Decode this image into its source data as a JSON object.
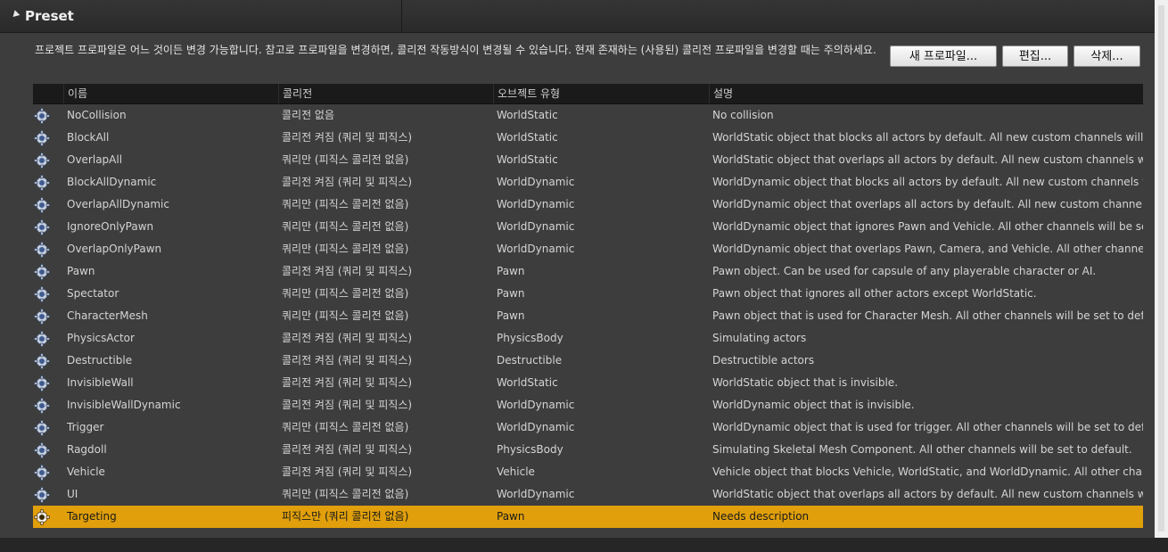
{
  "header": {
    "title": "Preset"
  },
  "description": "프로젝트 프로파일은 어느 것이든 변경 가능합니다. 참고로 프로파일을 변경하면, 콜리전 작동방식이 변경될 수 있습니다. 현재 존재하는 (사용된) 콜리전 프로파일을 변경할 때는 주의하세요.",
  "buttons": {
    "new": "새 프로파일...",
    "edit": "편집...",
    "delete": "삭제..."
  },
  "columns": [
    "이름",
    "콜리전",
    "오브젝트 유형",
    "설명"
  ],
  "rows": [
    {
      "name": "NoCollision",
      "collision": "콜리전 없음",
      "object": "WorldStatic",
      "desc": "No collision"
    },
    {
      "name": "BlockAll",
      "collision": "콜리전 켜짐 (쿼리 및 피직스)",
      "object": "WorldStatic",
      "desc": "WorldStatic object that blocks all actors by default. All new custom channels will use"
    },
    {
      "name": "OverlapAll",
      "collision": "쿼리만 (피직스 콜리전 없음)",
      "object": "WorldStatic",
      "desc": "WorldStatic object that overlaps all actors by default. All new custom channels will us"
    },
    {
      "name": "BlockAllDynamic",
      "collision": "콜리전 켜짐 (쿼리 및 피직스)",
      "object": "WorldDynamic",
      "desc": "WorldDynamic object that blocks all actors by default. All new custom channels will u"
    },
    {
      "name": "OverlapAllDynamic",
      "collision": "쿼리만 (피직스 콜리전 없음)",
      "object": "WorldDynamic",
      "desc": "WorldDynamic object that overlaps all actors by default. All new custom channels wil"
    },
    {
      "name": "IgnoreOnlyPawn",
      "collision": "쿼리만 (피직스 콜리전 없음)",
      "object": "WorldDynamic",
      "desc": "WorldDynamic object that ignores Pawn and Vehicle. All other channels will be set to d"
    },
    {
      "name": "OverlapOnlyPawn",
      "collision": "쿼리만 (피직스 콜리전 없음)",
      "object": "WorldDynamic",
      "desc": "WorldDynamic object that overlaps Pawn, Camera, and Vehicle. All other channels wi"
    },
    {
      "name": "Pawn",
      "collision": "콜리전 켜짐 (쿼리 및 피직스)",
      "object": "Pawn",
      "desc": "Pawn object. Can be used for capsule of any playerable character or AI."
    },
    {
      "name": "Spectator",
      "collision": "쿼리만 (피직스 콜리전 없음)",
      "object": "Pawn",
      "desc": "Pawn object that ignores all other actors except WorldStatic."
    },
    {
      "name": "CharacterMesh",
      "collision": "쿼리만 (피직스 콜리전 없음)",
      "object": "Pawn",
      "desc": "Pawn object that is used for Character Mesh. All other channels will be set to default."
    },
    {
      "name": "PhysicsActor",
      "collision": "콜리전 켜짐 (쿼리 및 피직스)",
      "object": "PhysicsBody",
      "desc": "Simulating actors"
    },
    {
      "name": "Destructible",
      "collision": "콜리전 켜짐 (쿼리 및 피직스)",
      "object": "Destructible",
      "desc": "Destructible actors"
    },
    {
      "name": "InvisibleWall",
      "collision": "콜리전 켜짐 (쿼리 및 피직스)",
      "object": "WorldStatic",
      "desc": "WorldStatic object that is invisible."
    },
    {
      "name": "InvisibleWallDynamic",
      "collision": "콜리전 켜짐 (쿼리 및 피직스)",
      "object": "WorldDynamic",
      "desc": "WorldDynamic object that is invisible."
    },
    {
      "name": "Trigger",
      "collision": "쿼리만 (피직스 콜리전 없음)",
      "object": "WorldDynamic",
      "desc": "WorldDynamic object that is used for trigger. All other channels will be set to default."
    },
    {
      "name": "Ragdoll",
      "collision": "콜리전 켜짐 (쿼리 및 피직스)",
      "object": "PhysicsBody",
      "desc": "Simulating Skeletal Mesh Component. All other channels will be set to default."
    },
    {
      "name": "Vehicle",
      "collision": "콜리전 켜짐 (쿼리 및 피직스)",
      "object": "Vehicle",
      "desc": "Vehicle object that blocks Vehicle, WorldStatic, and WorldDynamic. All other channels"
    },
    {
      "name": "UI",
      "collision": "쿼리만 (피직스 콜리전 없음)",
      "object": "WorldDynamic",
      "desc": "WorldStatic object that overlaps all actors by default. All new custom channels will us"
    },
    {
      "name": "Targeting",
      "collision": "피직스만 (쿼리 콜리전 없음)",
      "object": "Pawn",
      "desc": "Needs description",
      "selected": true
    }
  ],
  "colors": {
    "selected": "#e09f0b",
    "panel": "#3d3d3d",
    "header_row": "#1a1a1a"
  }
}
